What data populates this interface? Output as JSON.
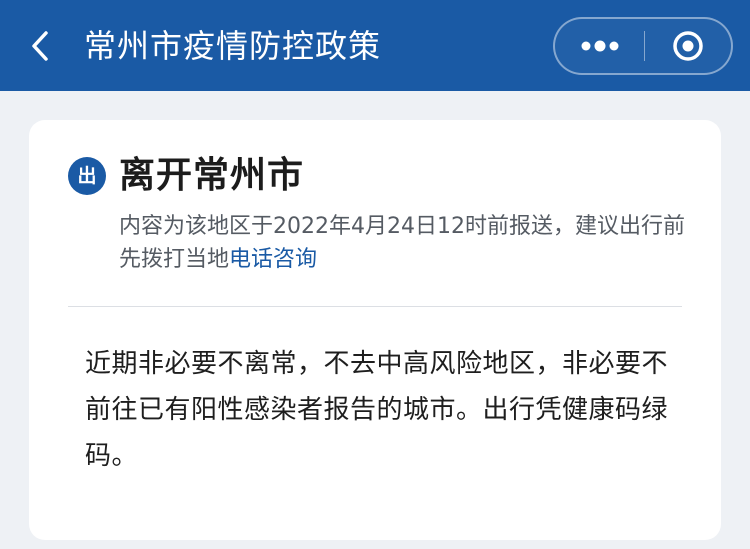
{
  "header": {
    "title": "常州市疫情防控政策",
    "back_icon": "chevron-left-icon",
    "more_icon": "more-dots-icon",
    "close_icon": "target-circle-icon",
    "background": "#1a5aa5"
  },
  "card": {
    "badge": "出",
    "title": "离开常州市",
    "notice_prefix": "内容为该地区于2022年4月24日12时前报送，建议出行前先拨打当地",
    "notice_link": "电话咨询",
    "policy": "近期非必要不离常，不去中高风险地区，非必要不前往已有阳性感染者报告的城市。出行凭健康码绿码。",
    "accent_color": "#1a5aa5"
  }
}
